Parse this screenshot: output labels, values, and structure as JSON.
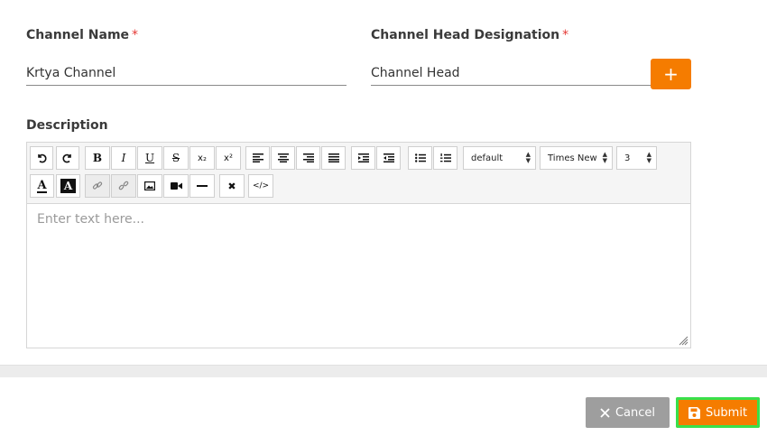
{
  "form": {
    "channel_name": {
      "label": "Channel Name",
      "required_mark": "*",
      "value": "Krtya Channel"
    },
    "channel_head": {
      "label": "Channel Head Designation",
      "required_mark": "*",
      "value": "Channel Head"
    },
    "add_button_label": "+",
    "description": {
      "label": "Description",
      "placeholder": "Enter text here...",
      "toolbar": {
        "bold": "B",
        "italic": "I",
        "underline": "U",
        "strike": "S",
        "subscript": "x₂",
        "superscript": "x²",
        "text_color": "A",
        "bg_color": "A",
        "format_select": "default",
        "font_select": "Times New",
        "size_select": "3",
        "clear": "✖",
        "code": "</>"
      }
    }
  },
  "footer": {
    "cancel_label": "Cancel",
    "submit_label": "Submit"
  },
  "colors": {
    "accent": "#f57c00",
    "cancel": "#9e9e9e",
    "submit_outline": "#39e04a",
    "required": "#e53935"
  }
}
